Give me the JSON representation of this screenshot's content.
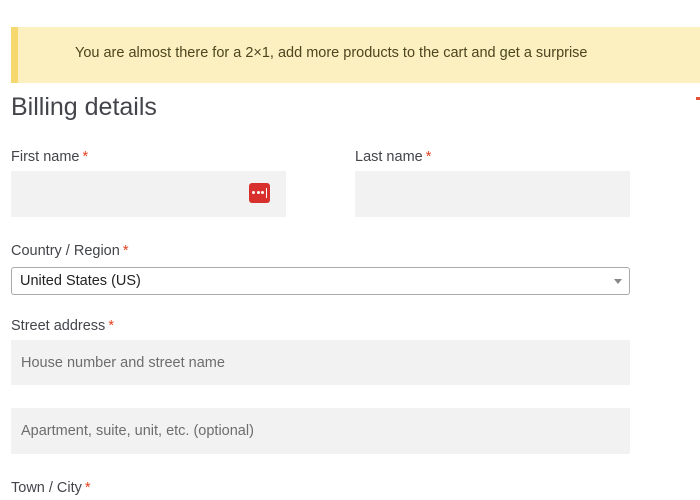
{
  "notice": {
    "text": "You are almost there for a 2×1, add more products to the cart and get a surprise"
  },
  "billing": {
    "heading": "Billing details",
    "required_marker": "*",
    "first_name": {
      "label": "First name",
      "value": "",
      "password_manager_icon": "password-manager-icon"
    },
    "last_name": {
      "label": "Last name",
      "value": ""
    },
    "country": {
      "label": "Country / Region",
      "selected": "United States (US)"
    },
    "street": {
      "label": "Street address",
      "line1_placeholder": "House number and street name",
      "line2_placeholder": "Apartment, suite, unit, etc. (optional)"
    },
    "city": {
      "label": "Town / City"
    }
  },
  "colors": {
    "notice_bg": "#fdf0c0",
    "notice_border": "#f5d86e",
    "required": "#e2401c",
    "field_bg": "#f2f2f2",
    "pw_icon": "#d8312d"
  }
}
